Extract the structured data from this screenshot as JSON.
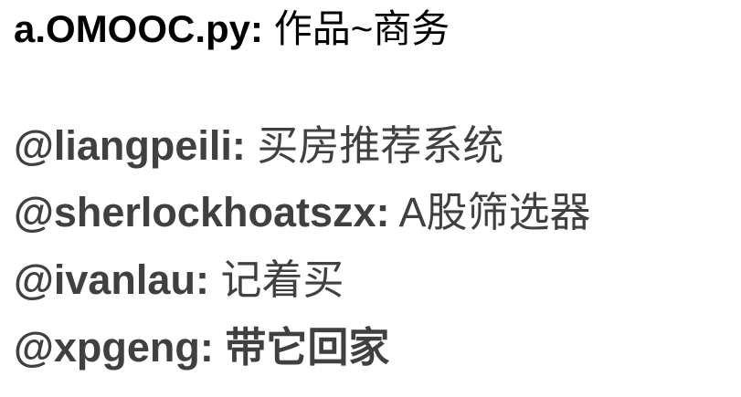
{
  "title": {
    "handle": "a.OMOOC.py:",
    "text": "作品~商务"
  },
  "entries": [
    {
      "handle": "@liangpeili:",
      "text": "买房推荐系统"
    },
    {
      "handle": "@sherlockhoatszx:",
      "text": "A股筛选器"
    },
    {
      "handle": "@ivanlau:",
      "text": "记着买"
    },
    {
      "handle": "@xpgeng:",
      "text": "带它回家"
    }
  ],
  "colors": {
    "title_text": "#000000",
    "entry_text": "#404040",
    "background": "#ffffff"
  }
}
